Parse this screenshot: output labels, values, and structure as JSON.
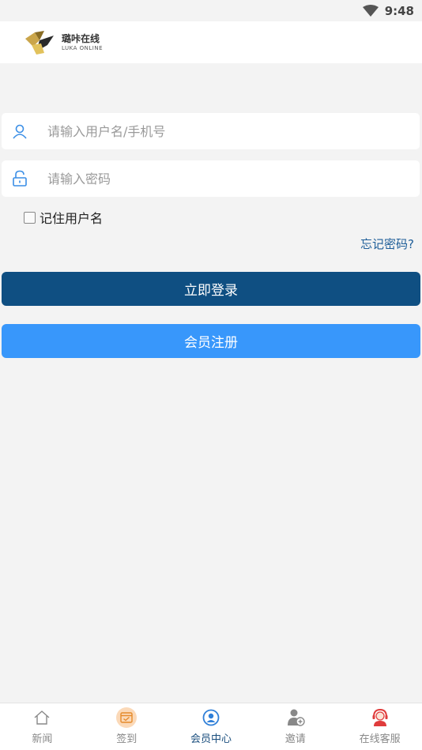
{
  "status": {
    "time": "9:48"
  },
  "header": {
    "logo_cn": "璐咔在线",
    "logo_en": "LUKA ONLINE"
  },
  "form": {
    "username_placeholder": "请输入用户名/手机号",
    "password_placeholder": "请输入密码",
    "remember_label": "记住用户名",
    "forgot_label": "忘记密码?",
    "login_label": "立即登录",
    "register_label": "会员注册"
  },
  "tabs": [
    {
      "label": "新闻",
      "icon": "home-icon"
    },
    {
      "label": "签到",
      "icon": "calendar-check-icon"
    },
    {
      "label": "会员中心",
      "icon": "user-circle-icon"
    },
    {
      "label": "邀请",
      "icon": "user-add-icon"
    },
    {
      "label": "在线客服",
      "icon": "support-agent-icon"
    }
  ],
  "colors": {
    "login_button": "#0f4f82",
    "register_button": "#3897fb",
    "active_tab": "#1b4f7e",
    "link": "#1d5d98"
  }
}
